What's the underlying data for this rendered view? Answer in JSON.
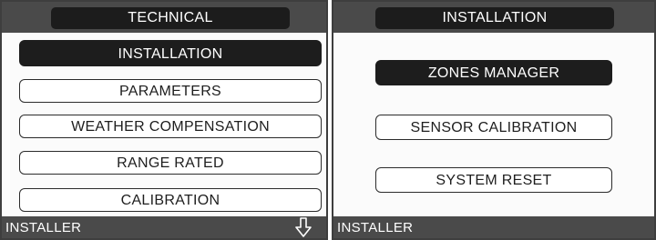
{
  "left_screen": {
    "title": "TECHNICAL",
    "menu_items": [
      {
        "label": "INSTALLATION",
        "selected": true
      },
      {
        "label": "PARAMETERS",
        "selected": false
      },
      {
        "label": "WEATHER COMPENSATION",
        "selected": false
      },
      {
        "label": "RANGE RATED",
        "selected": false
      },
      {
        "label": "CALIBRATION",
        "selected": false
      }
    ],
    "footer": {
      "label": "INSTALLER",
      "icon": "down-arrow-icon"
    }
  },
  "right_screen": {
    "title": "INSTALLATION",
    "menu_items": [
      {
        "label": "ZONES MANAGER",
        "selected": true
      },
      {
        "label": "SENSOR CALIBRATION",
        "selected": false
      },
      {
        "label": "SYSTEM RESET",
        "selected": false
      }
    ],
    "footer": {
      "label": "INSTALLER"
    }
  }
}
